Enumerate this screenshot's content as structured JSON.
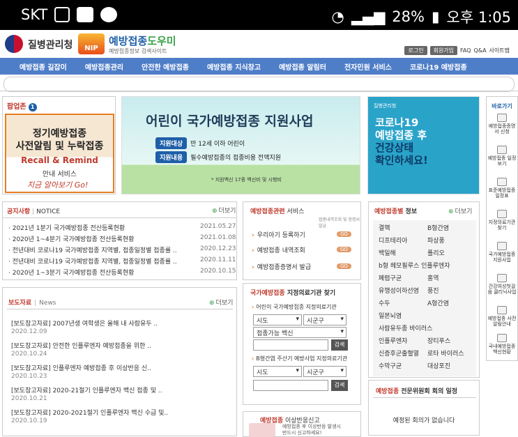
{
  "status_bar": {
    "carrier": "SKT",
    "battery": "28%",
    "time": "오후 1:05"
  },
  "header": {
    "org_name": "질병관리청",
    "badge": "NIP",
    "brand_main": "예방접종",
    "brand_accent": "도우미",
    "brand_sub": "예방접종정보 검색사이트",
    "top_links": [
      "로그인",
      "회원가입",
      "FAQ",
      "Q&A",
      "사이트맵"
    ]
  },
  "nav": [
    "예방접종 길잡이",
    "예방접종관리",
    "안전한 예방접종",
    "예방접종 지식창고",
    "예방접종 알림터",
    "전자민원 서비스",
    "코로나19 예방접종"
  ],
  "popup": {
    "header": "팝업존",
    "count": "1",
    "line1": "정기예방접종",
    "line2": "사전알림 및 누락접종",
    "line3": "Recall & Remind",
    "line4": "안내 서비스",
    "line5": "지금 알아보기 Go!"
  },
  "banner": {
    "title": "어린이 국가예방접종 지원사업",
    "target_tag": "지원대상",
    "target_text": "만 12세 이하 어린이",
    "content_tag": "지원내용",
    "content_text": "필수예방접종의 접종비용 전액지원",
    "note": "* 지원백신 17종 백신비 및 시행비"
  },
  "covid_banner": {
    "org": "질병관리청",
    "l1": "코로나19",
    "l2": "예방접종 후",
    "l3": "건강상태",
    "l4": "확인하세요!"
  },
  "quick_menu": {
    "header": "바로가기",
    "items": [
      "예방접종증명서 신청",
      "예방접종 일정보기",
      "표준예방접종 일정표",
      "지정의료기관 찾기",
      "국가예방접종 지원사업",
      "건강여성첫걸음 클리닉사업",
      "예방접종 사전알림안내",
      "국내예방접종 백신현황"
    ]
  },
  "notice": {
    "tab_ko": "공지사항",
    "tab_en": "NOTICE",
    "more": "더보기",
    "items": [
      {
        "title": "· 2021년 1분기 국가예방접종 전산등록현황",
        "date": "2021.05.27"
      },
      {
        "title": "· 2020년 1~4분기 국가예방접종 전산등록현황",
        "date": "2021.01.08"
      },
      {
        "title": "· 전년대비 코로나19 국가예방접종 지역별, 접종일정별 접종률 ..",
        "date": "2020.12.23"
      },
      {
        "title": "· 전년대비 코로나19 국가예방접종 지역별, 접종일정별 접종률 ..",
        "date": "2020.11.11"
      },
      {
        "title": "· 2020년 1~3분기 국가예방접종 전산등록현황",
        "date": "2020.10.15"
      }
    ]
  },
  "press": {
    "tab_ko": "보도자료",
    "tab_en": "News",
    "more": "더보기",
    "items": [
      {
        "title": "[보도참고자료] 2007년생 여학생은 올해 내 사람유두 ..",
        "date": "2020.12.09"
      },
      {
        "title": "[보도참고자료] 안전한 인플루엔자 예방접종을 위한 ..",
        "date": "2020.10.24"
      },
      {
        "title": "[보도참고자료] 인플루엔자 예방접종 후 이상반응 신..",
        "date": "2020.10.23"
      },
      {
        "title": "[보도참고자료] 2020-21절기 인플루엔자 백신 접종 및 ..",
        "date": "2020.10.21"
      },
      {
        "title": "[보도참고자료] 2020-2021절기 인플루엔자 백신 수급 및..",
        "date": "2020.10.19"
      }
    ]
  },
  "services": {
    "title_a": "예방접종관련",
    "title_b": " 서비스",
    "sub": "접종내역조회 및 증명서발급",
    "items": [
      "우리아기 등록하기",
      "예방접종 내역조회",
      "예방접종증명서 발급"
    ],
    "go": "GO"
  },
  "finder": {
    "title_a": "국가예방접종",
    "title_b": " 지정의료기관 찾기",
    "child_label": "어린이 국가예방접종 지정의료기관",
    "sido": "시도",
    "sigungu": "시군구",
    "vaccine": "접종가능 백신",
    "search": "검색",
    "hepb_label": "B형간염 주산기 예방사업 지정의료기관"
  },
  "adverse": {
    "title_a": "예방접종",
    "title_b": " 이상반응신고",
    "desc1": "예방접종 후 이상반응 발생시",
    "desc2": "반드시 신고하세요!"
  },
  "diseases": {
    "title_a": "예방접종별",
    "title_b": " 정보",
    "more": "더보기",
    "left": [
      "결핵",
      "디프테리아",
      "백일해",
      "b형 헤모필루스 인플루엔자",
      "폐렴구균",
      "유행성이하선염",
      "수두",
      "일본뇌염",
      "사람유두종 바이러스",
      "인플루엔자",
      "신증후군출혈열",
      "수막구균"
    ],
    "right": [
      "B형간염",
      "파상풍",
      "폴리오",
      "홍역",
      "풍진",
      "A형간염",
      "장티푸스",
      "로타 바이러스",
      "대상포진"
    ]
  },
  "committee": {
    "title_a": "예방접종",
    "title_b": " 전문위원회 회의 일정",
    "message": "예정된 회의가 없습니다"
  }
}
